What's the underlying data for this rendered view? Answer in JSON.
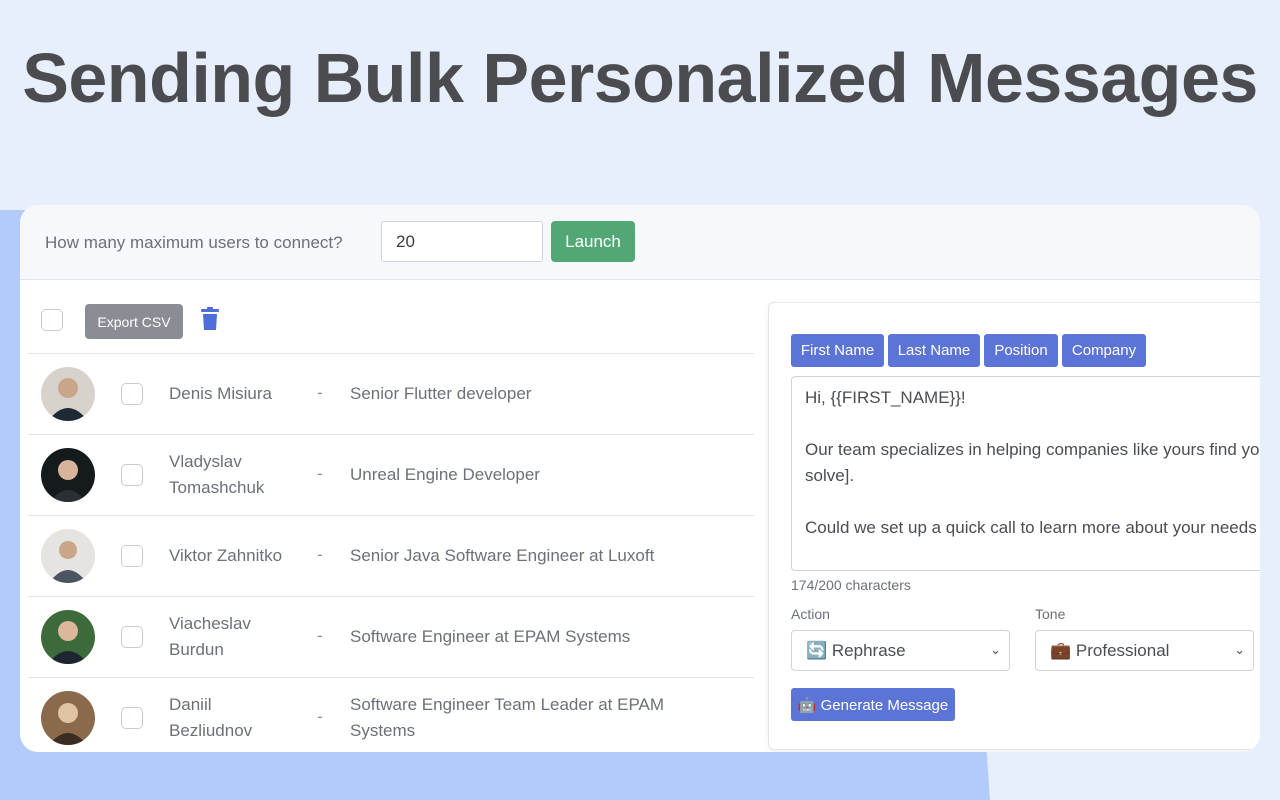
{
  "hero": {
    "title": "Sending Bulk Personalized Messages"
  },
  "topbar": {
    "label": "How many maximum users to connect?",
    "max_users_value": "20",
    "launch_label": "Launch"
  },
  "toolbar": {
    "export_label": "Export CSV"
  },
  "contacts": [
    {
      "name": "Denis Misiura",
      "dash": "-",
      "position": "Senior Flutter developer"
    },
    {
      "name": "Vladyslav Tomashchuk",
      "dash": "-",
      "position": "Unreal Engine Developer"
    },
    {
      "name": "Viktor Zahnitko",
      "dash": "-",
      "position": "Senior Java Software Engineer at Luxoft"
    },
    {
      "name": "Viacheslav Burdun",
      "dash": "-",
      "position": "Software Engineer at EPAM Systems"
    },
    {
      "name": "Daniil Bezliudnov",
      "dash": "-",
      "position": "Software Engineer Team Leader at EPAM Systems"
    }
  ],
  "composer": {
    "fields": [
      "First Name",
      "Last Name",
      "Position",
      "Company"
    ],
    "message": "Hi, {{FIRST_NAME}}!\n\nOur team specializes in helping companies like yours find yo\nsolve].\n\nCould we set up a quick call to learn more about your needs",
    "char_count": "174/200 characters",
    "action_label": "Action",
    "action_value": "🔄 Rephrase",
    "tone_label": "Tone",
    "tone_value": "💼 Professional",
    "generate_label": "🤖 Generate Message"
  },
  "colors": {
    "accent": "#5b74d6",
    "launch": "#52a874",
    "export": "#8a8d94",
    "page_bg": "#e8effc",
    "shape_bg": "#b3cbfa"
  }
}
